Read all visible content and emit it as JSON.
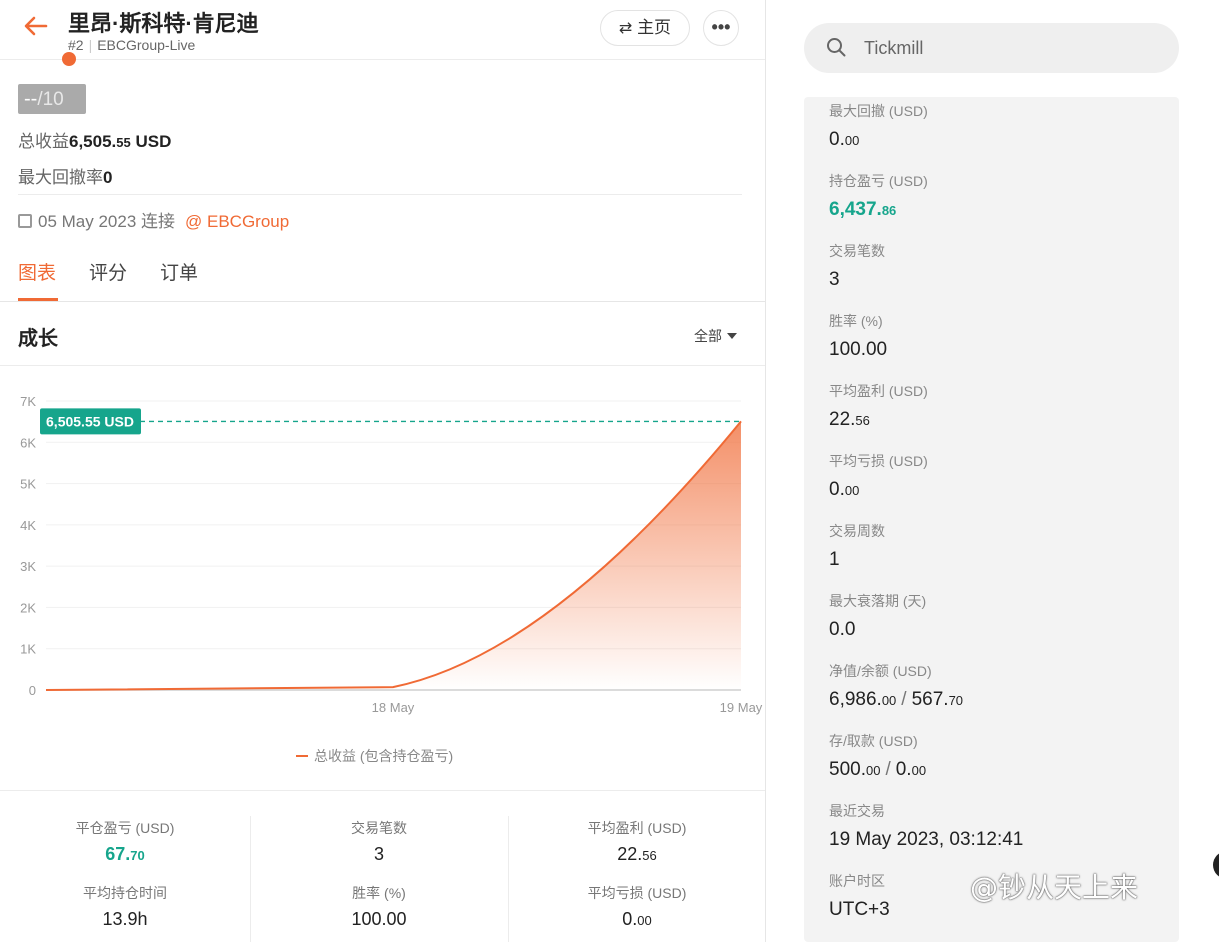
{
  "header": {
    "title": "里昂·斯科特·肯尼迪",
    "rank": "#2",
    "account": "EBCGroup-Live",
    "home_label": "主页",
    "more_label": "•••"
  },
  "profile": {
    "score_value": "--",
    "score_max": "/10",
    "total_profit_label": "总收益",
    "total_profit_main": "6,505.",
    "total_profit_dec": "55",
    "total_profit_unit": "USD",
    "max_drawdown_label": "最大回撤率",
    "max_drawdown_value": "0",
    "joined_date": "05 May 2023 连接",
    "broker_link": "@ EBCGroup"
  },
  "tabs": [
    {
      "label": "图表",
      "active": true
    },
    {
      "label": "评分",
      "active": false
    },
    {
      "label": "订单",
      "active": false
    }
  ],
  "chart_section": {
    "title": "成长",
    "range_label": "全部"
  },
  "chart_data": {
    "type": "area",
    "x_labels": [
      "18 May",
      "19 May"
    ],
    "x_ticks": [
      "18 May",
      "19 May"
    ],
    "y_ticks": [
      "0",
      "1K",
      "2K",
      "3K",
      "4K",
      "5K",
      "6K",
      "7K"
    ],
    "ylim": [
      0,
      7000
    ],
    "points": [
      {
        "x": "start",
        "y": 0
      },
      {
        "x": "18 May",
        "y": 70
      },
      {
        "x": "19 May",
        "y": 6505.55
      }
    ],
    "current_label": "6,505.55 USD",
    "current_value": 6505.55,
    "legend": "总收益 (包含持仓盈亏)",
    "colors": {
      "line": "#f06a35",
      "marker": "#16a58c"
    }
  },
  "summary": [
    {
      "label": "平仓盈亏 (USD)",
      "main": "67.",
      "dec": "70",
      "green": true
    },
    {
      "label": "交易笔数",
      "main": "3",
      "dec": "",
      "green": false
    },
    {
      "label": "平均盈利 (USD)",
      "main": "22.",
      "dec": "56",
      "green": false
    },
    {
      "label": "平均持仓时间",
      "main": "13.9h",
      "dec": "",
      "green": false
    },
    {
      "label": "胜率 (%)",
      "main": "100.00",
      "dec": "",
      "green": false
    },
    {
      "label": "平均亏损 (USD)",
      "main": "0.",
      "dec": "00",
      "green": false
    }
  ],
  "search": {
    "text": "Tickmill"
  },
  "stats": [
    {
      "label": "最大回撤 (USD)",
      "main": "0.",
      "dec": "00"
    },
    {
      "label": "持仓盈亏 (USD)",
      "main": "6,437.",
      "dec": "86",
      "green": true
    },
    {
      "label": "交易笔数",
      "main": "3",
      "dec": ""
    },
    {
      "label": "胜率 (%)",
      "main": "100.00",
      "dec": ""
    },
    {
      "label": "平均盈利 (USD)",
      "main": "22.",
      "dec": "56"
    },
    {
      "label": "平均亏损 (USD)",
      "main": "0.",
      "dec": "00"
    },
    {
      "label": "交易周数",
      "main": "1",
      "dec": ""
    },
    {
      "label": "最大衰落期 (天)",
      "main": "0.0",
      "dec": ""
    },
    {
      "label": "净值/余额 (USD)",
      "main": "6,986.",
      "dec": "00",
      "main2": "567.",
      "dec2": "70"
    },
    {
      "label": "存/取款 (USD)",
      "main": "500.",
      "dec": "00",
      "main2": "0.",
      "dec2": "00"
    },
    {
      "label": "最近交易",
      "main": "19 May 2023, 03:12:41",
      "dec": ""
    },
    {
      "label": "账户时区",
      "main": "UTC+3",
      "dec": ""
    }
  ],
  "watermark": "@钞从天上来"
}
